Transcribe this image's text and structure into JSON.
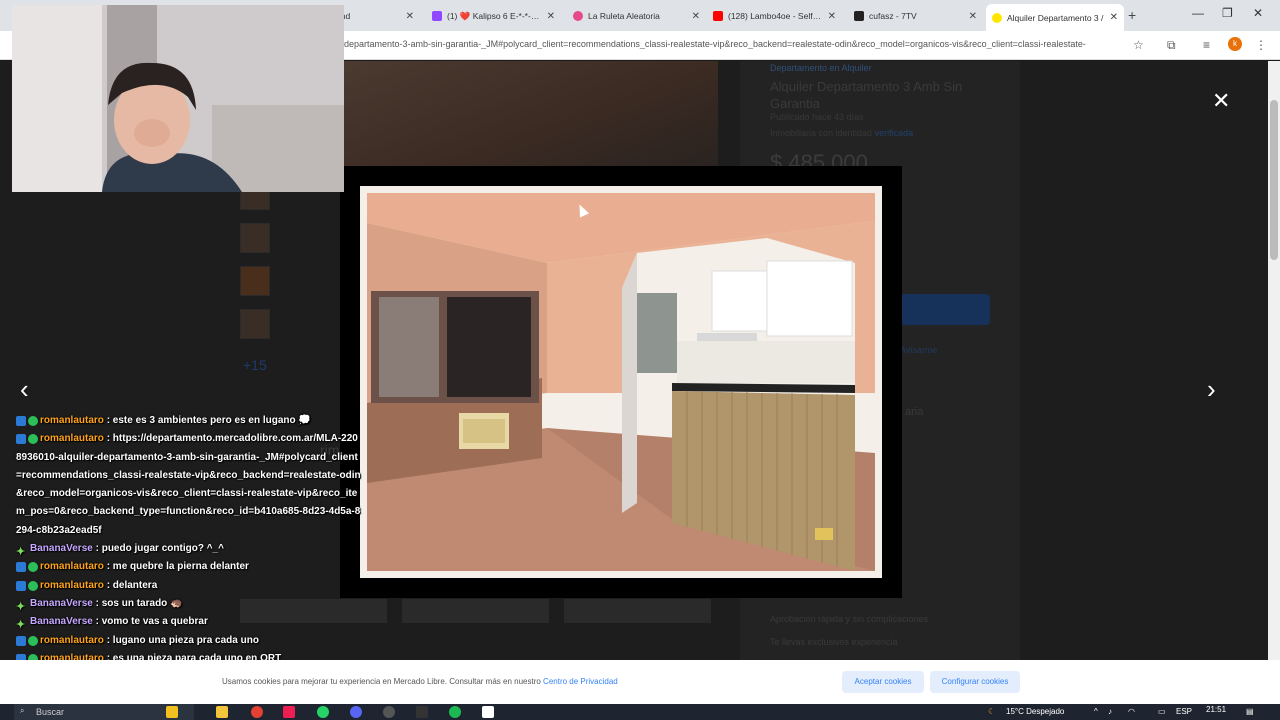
{
  "browser": {
    "tabs": [
      {
        "title": "und",
        "favicon_color": "#ffffff"
      },
      {
        "title": "(1) ❤️ Kalipso 6 E-*-*-3-o *",
        "favicon_color": "#9146ff"
      },
      {
        "title": "La Ruleta Aleatoria",
        "favicon_color": "#e64a8a"
      },
      {
        "title": "(128) Lambo4oe - Self Em",
        "favicon_color": "#ff0000"
      },
      {
        "title": "cufasz - 7TV",
        "favicon_color": "#222222"
      },
      {
        "title": "Alquiler Departamento 3 /",
        "favicon_color": "#ffe600"
      }
    ],
    "url": "departamento-3-amb-sin-garantia-_JM#polycard_client=recommendations_classi-realestate-vip&reco_backend=realestate-odin&reco_model=organicos-vis&reco_client=classi-realestate-",
    "profile_initial": "k"
  },
  "listing": {
    "type": "Departamento en Alquiler",
    "title": "Alquiler Departamento 3 Amb Sin Garantia",
    "published": "Publicado hace 43 días",
    "seller_prefix": "Inmobiliaria con identidad",
    "seller_verified": "verificada",
    "price": "$ 485.000",
    "thumbs_more": "+15",
    "link_partial": "Avisarme",
    "text_partial": "aria",
    "benefits": [
      "Aprobación rápida y sin complicaciones",
      "Te llevas exclusivos experiencia"
    ],
    "similar_cards": [
      "Departamento en alquiler\nAlquiler De 3 Ambientes Al",
      "Departamento en alquiler\nDepartamento 3 Ambientes Al",
      "Departamento en alquiler\nAlquiler 2 Ambientes En"
    ],
    "similar_heading_partial": "rimos"
  },
  "webcam": {
    "label": "webcam"
  },
  "chat": [
    {
      "badge": "mod",
      "user": "romanlautaro",
      "text": ": este es 3 ambientes pero es en lugano 💭"
    },
    {
      "badge": "mod",
      "user": "romanlautaro",
      "text": ": https://departamento.mercadolibre.com.ar/MLA-2208936010-alquiler-departamento-3-amb-sin-garantia-_JM#polycard_client=recommendations_classi-realestate-vip&reco_backend=realestate-odin&reco_model=organicos-vis&reco_client=classi-realestate-vip&reco_item_pos=0&reco_backend_type=function&reco_id=b410a685-8d23-4d5a-8294-c8b23a2ead5f"
    },
    {
      "badge": "sub",
      "user": "BananaVerse",
      "text": ": puedo jugar contigo? ^_^"
    },
    {
      "badge": "mod",
      "user": "romanlautaro",
      "text": ": me quebre la pierna delanter"
    },
    {
      "badge": "mod",
      "user": "romanlautaro",
      "text": ": delantera"
    },
    {
      "badge": "sub",
      "user": "BananaVerse",
      "text": ": sos un tarado 🦔"
    },
    {
      "badge": "sub",
      "user": "BananaVerse",
      "text": ": vomo te vas a quebrar"
    },
    {
      "badge": "mod",
      "user": "romanlautaro",
      "text": ": lugano una pieza pra cada uno"
    },
    {
      "badge": "mod",
      "user": "romanlautaro",
      "text": ": es una pieza para cada uno en ORT"
    }
  ],
  "cookies": {
    "text": "Usamos cookies para mejorar tu experiencia en Mercado Libre. Consultar más en nuestro ",
    "link": "Centro de Privacidad",
    "accept": "Aceptar cookies",
    "configure": "Configurar cookies"
  },
  "taskbar": {
    "search_placeholder": "Buscar",
    "weather": "15°C  Despejado",
    "lang": "ESP",
    "time": "21:51"
  },
  "icons": {
    "close": "close-icon",
    "prev": "chevron-left-icon",
    "next": "chevron-right-icon"
  }
}
